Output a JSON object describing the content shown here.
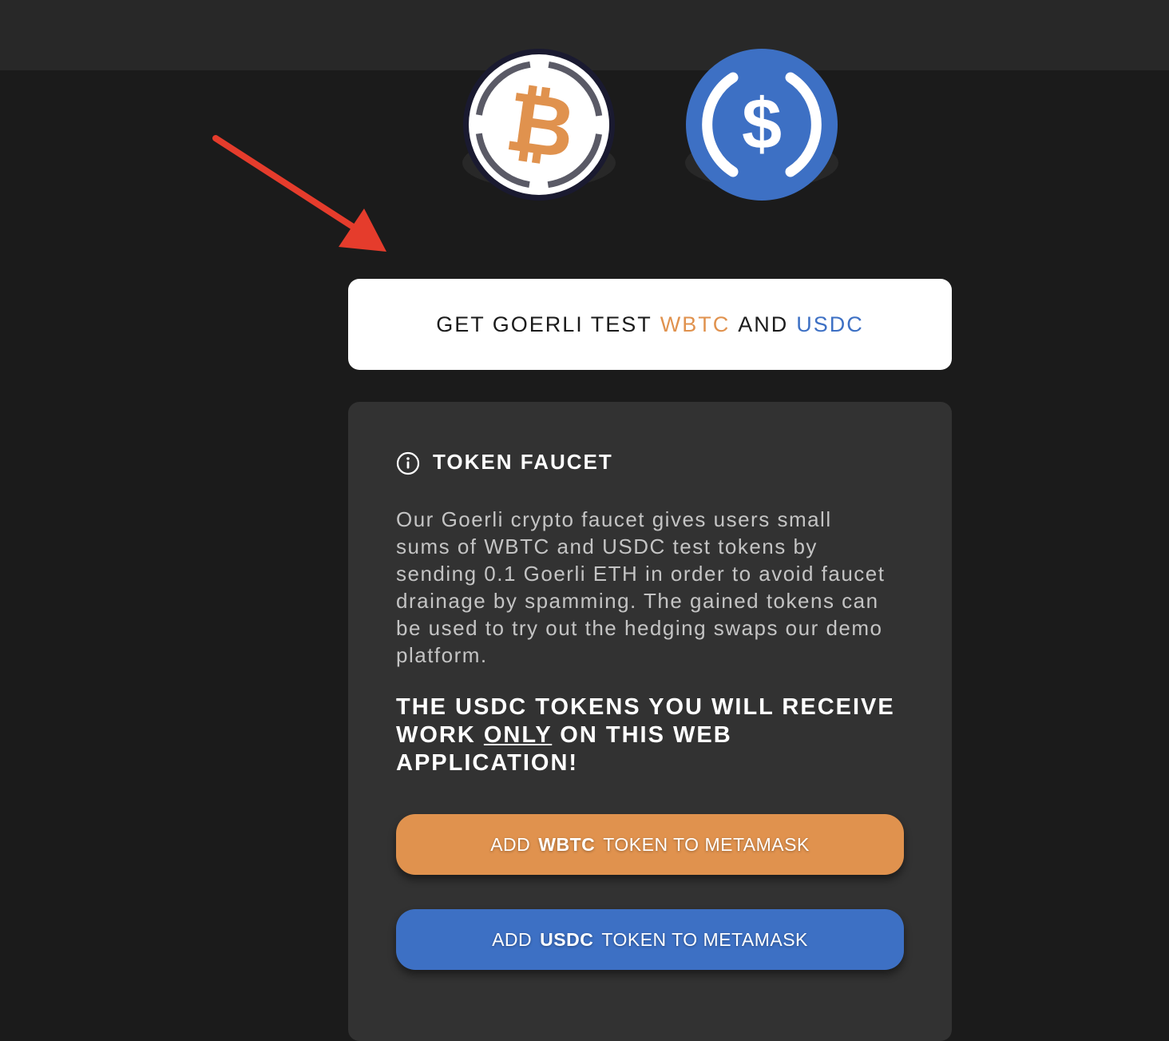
{
  "title_card": {
    "prefix": "GET GOERLI TEST",
    "token1": "WBTC",
    "joiner": "AND",
    "token2": "USDC"
  },
  "faucet": {
    "title": "TOKEN FAUCET",
    "description": "Our Goerli crypto faucet gives users small sums of WBTC and USDC test tokens by sending 0.1 Goerli ETH in order to avoid faucet drainage by spamming. The gained tokens can be used to try out the hedging swaps our demo platform.",
    "warning_before": "THE USDC TOKENS YOU WILL RECEIVE WORK ",
    "warning_emphasis": "ONLY",
    "warning_after": " ON THIS WEB APPLICATION!"
  },
  "buttons": {
    "wbtc": {
      "prefix": "ADD",
      "token": "WBTC",
      "suffix": "TOKEN TO METAMASK"
    },
    "usdc": {
      "prefix": "ADD",
      "token": "USDC",
      "suffix": "TOKEN TO METAMASK"
    }
  },
  "icons": {
    "coin1": "wbtc-coin-icon",
    "coin2": "usdc-coin-icon",
    "info": "info-icon",
    "annotation": "red-arrow-annotation"
  },
  "colors": {
    "wbtc": "#e0924e",
    "usdc": "#3d70c4",
    "arrow": "#e53c2c",
    "background": "#1b1b1b",
    "card": "#323232"
  }
}
